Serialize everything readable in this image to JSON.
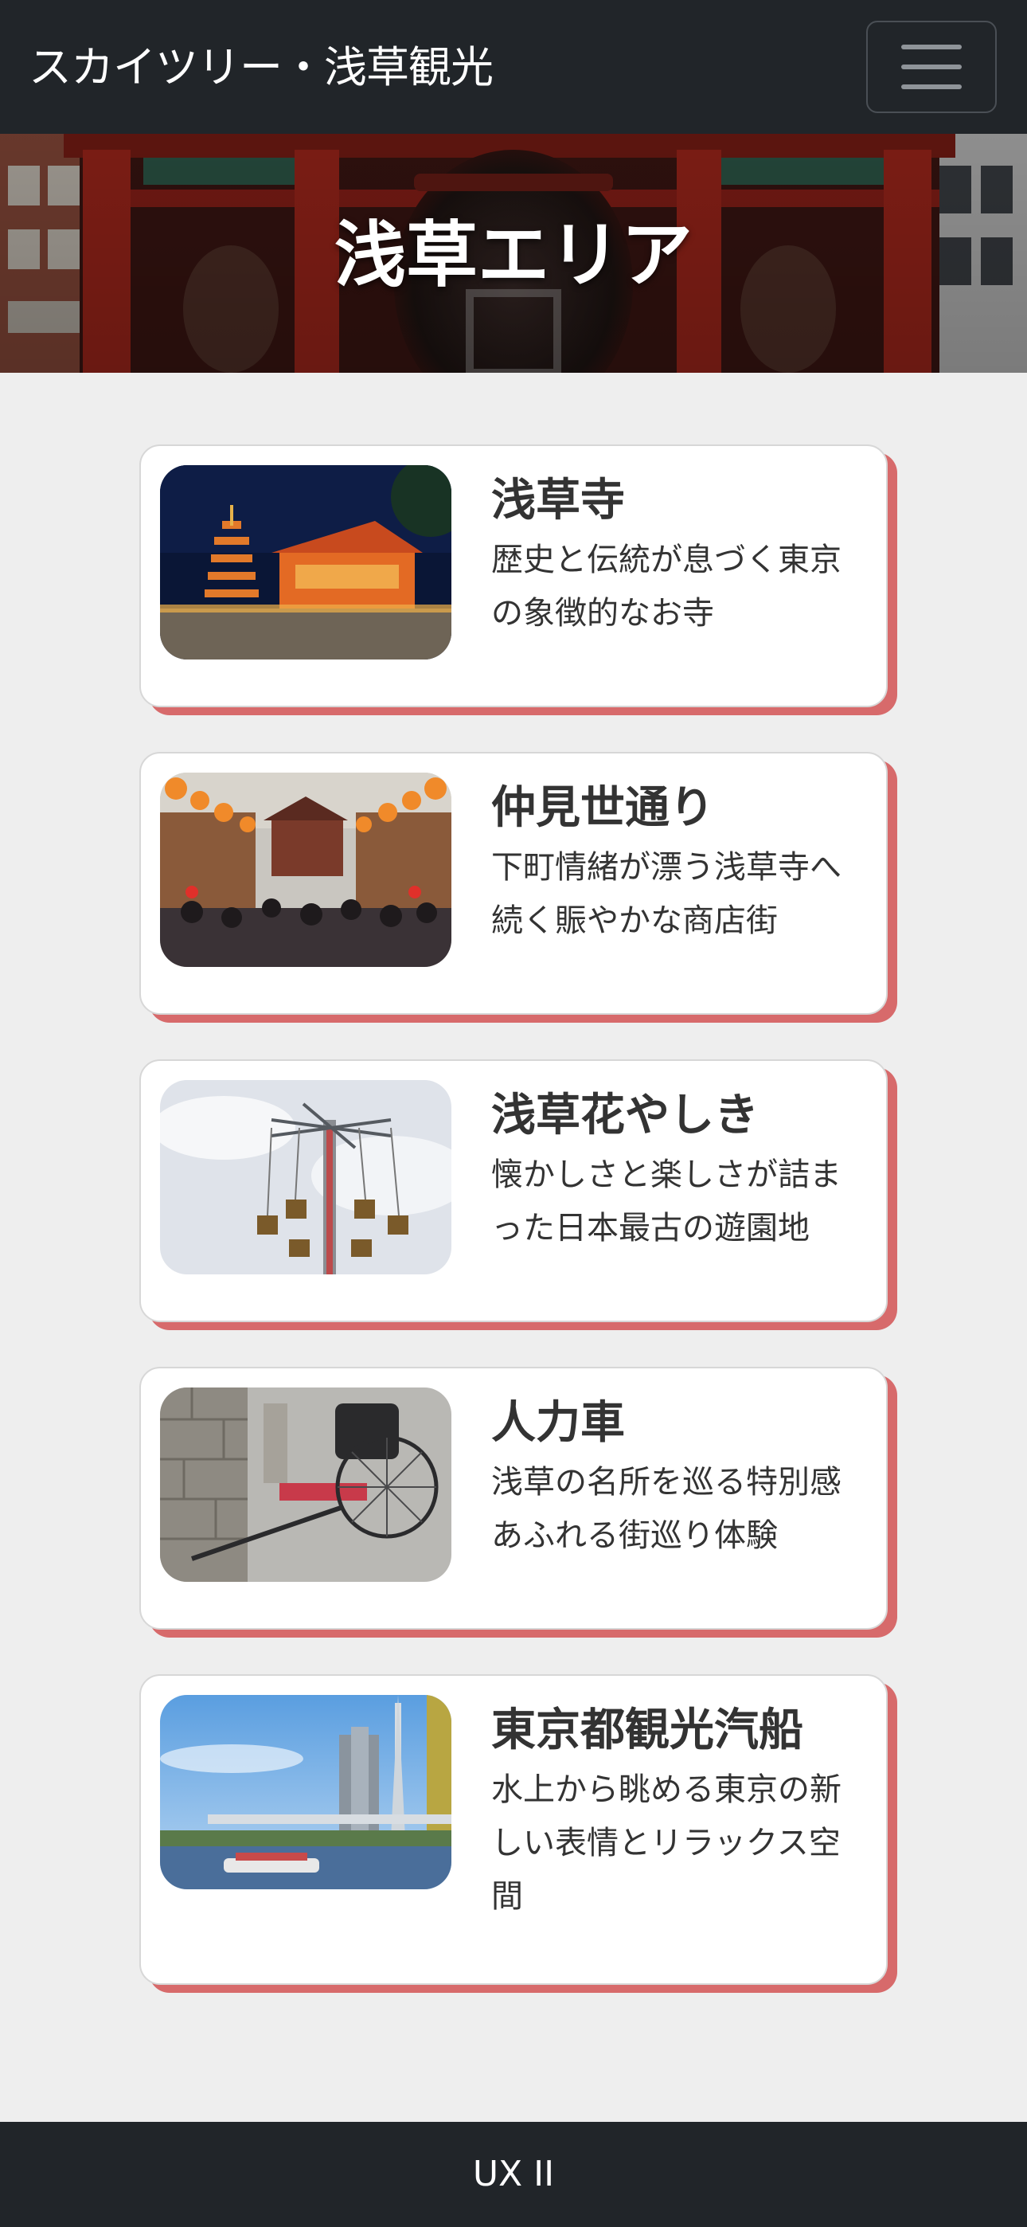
{
  "header": {
    "brand": "スカイツリー・浅草観光",
    "menu_icon": "hamburger-menu-icon"
  },
  "hero": {
    "title": "浅草エリア"
  },
  "cards": [
    {
      "title": "浅草寺",
      "description": "歴史と伝統が息づく東京の象徴的なお寺"
    },
    {
      "title": "仲見世通り",
      "description": "下町情緒が漂う浅草寺へ続く賑やかな商店街"
    },
    {
      "title": "浅草花やしき",
      "description": "懐かしさと楽しさが詰まった日本最古の遊園地"
    },
    {
      "title": "人力車",
      "description": "浅草の名所を巡る特別感あふれる街巡り体験"
    },
    {
      "title": "東京都観光汽船",
      "description": "水上から眺める東京の新しい表情とリラックス空間"
    }
  ],
  "footer": {
    "text": "UX II"
  },
  "colors": {
    "navbar": "#212529",
    "page_background": "#eeeeee",
    "card_accent": "#d76a6b",
    "text": "#333333"
  }
}
